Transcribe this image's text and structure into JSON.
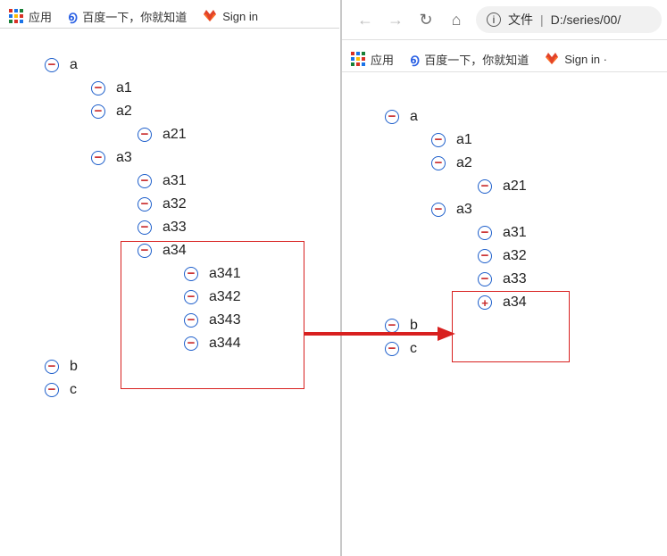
{
  "bookmarks": {
    "apps": "应用",
    "baidu": "百度一下，你就知道",
    "gitlab_left": "Sign in",
    "gitlab_right": "Sign in · "
  },
  "toolbar": {
    "file_label": "文件",
    "divider": " | ",
    "path": "D:/series/00/"
  },
  "left_tree": {
    "a": "a",
    "a1": "a1",
    "a2": "a2",
    "a21": "a21",
    "a3": "a3",
    "a31": "a31",
    "a32": "a32",
    "a33": "a33",
    "a34": "a34",
    "a341": "a341",
    "a342": "a342",
    "a343": "a343",
    "a344": "a344",
    "b": "b",
    "c": "c"
  },
  "right_tree": {
    "a": "a",
    "a1": "a1",
    "a2": "a2",
    "a21": "a21",
    "a3": "a3",
    "a31": "a31",
    "a32": "a32",
    "a33": "a33",
    "a34": "a34",
    "b": "b",
    "c": "c"
  }
}
